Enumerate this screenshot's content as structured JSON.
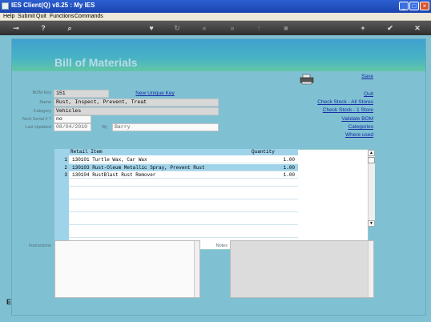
{
  "window": {
    "title": "IES Client(Q) v8.25 : My IES"
  },
  "menu": [
    "Help",
    "Submit",
    "Quit",
    "Functions",
    "Commands"
  ],
  "toolbar": {
    "icons": [
      "key-icon",
      "help-icon",
      "search-icon",
      "heart-icon",
      "refresh-icon",
      "rewind-icon",
      "fast-forward-icon",
      "up-icon",
      "stop-icon",
      "add-icon",
      "check-icon",
      "close-icon"
    ]
  },
  "page": {
    "title": "Bill of Materials"
  },
  "form": {
    "bom_key_label": "BOM Key",
    "bom_key_value": "151",
    "new_unique_key": "New Unique Key",
    "name_label": "Name",
    "name_value": "Rust, Inspect, Prevent, Treat",
    "category_label": "Category",
    "category_value": "Vehicles",
    "next_serial_label": "Next Serial # ?",
    "next_serial_value": "no",
    "last_updated_label": "Last Updated",
    "last_updated_value": "08/04/2010",
    "by_label": "By",
    "by_value": "Barry"
  },
  "links": {
    "save": "Save",
    "quit": "Quit",
    "check_all": "Check Stock - All Stores",
    "check_one": "Check Stock - 1 Store",
    "validate": "Validate BOM",
    "categories": "Categories",
    "where_used": "Where used"
  },
  "grid": {
    "col_item": "Retail Item",
    "col_qty": "Quantity",
    "rows": [
      {
        "num": "1",
        "item": "130101 Turtle Wax, Car Wax",
        "qty": "1.00"
      },
      {
        "num": "2",
        "item": "130103 Rust-Oleum Metallic Spray, Prevent Rust",
        "qty": "1.00"
      },
      {
        "num": "3",
        "item": "130104 RustBlast Rust Remover",
        "qty": "1.00"
      }
    ]
  },
  "memos": {
    "instructions_label": "Instructions",
    "notes_label": "Notes"
  },
  "colors": {
    "background": "#7fc1d2",
    "link": "#1a2aa8",
    "header": "#3fa0cf"
  }
}
